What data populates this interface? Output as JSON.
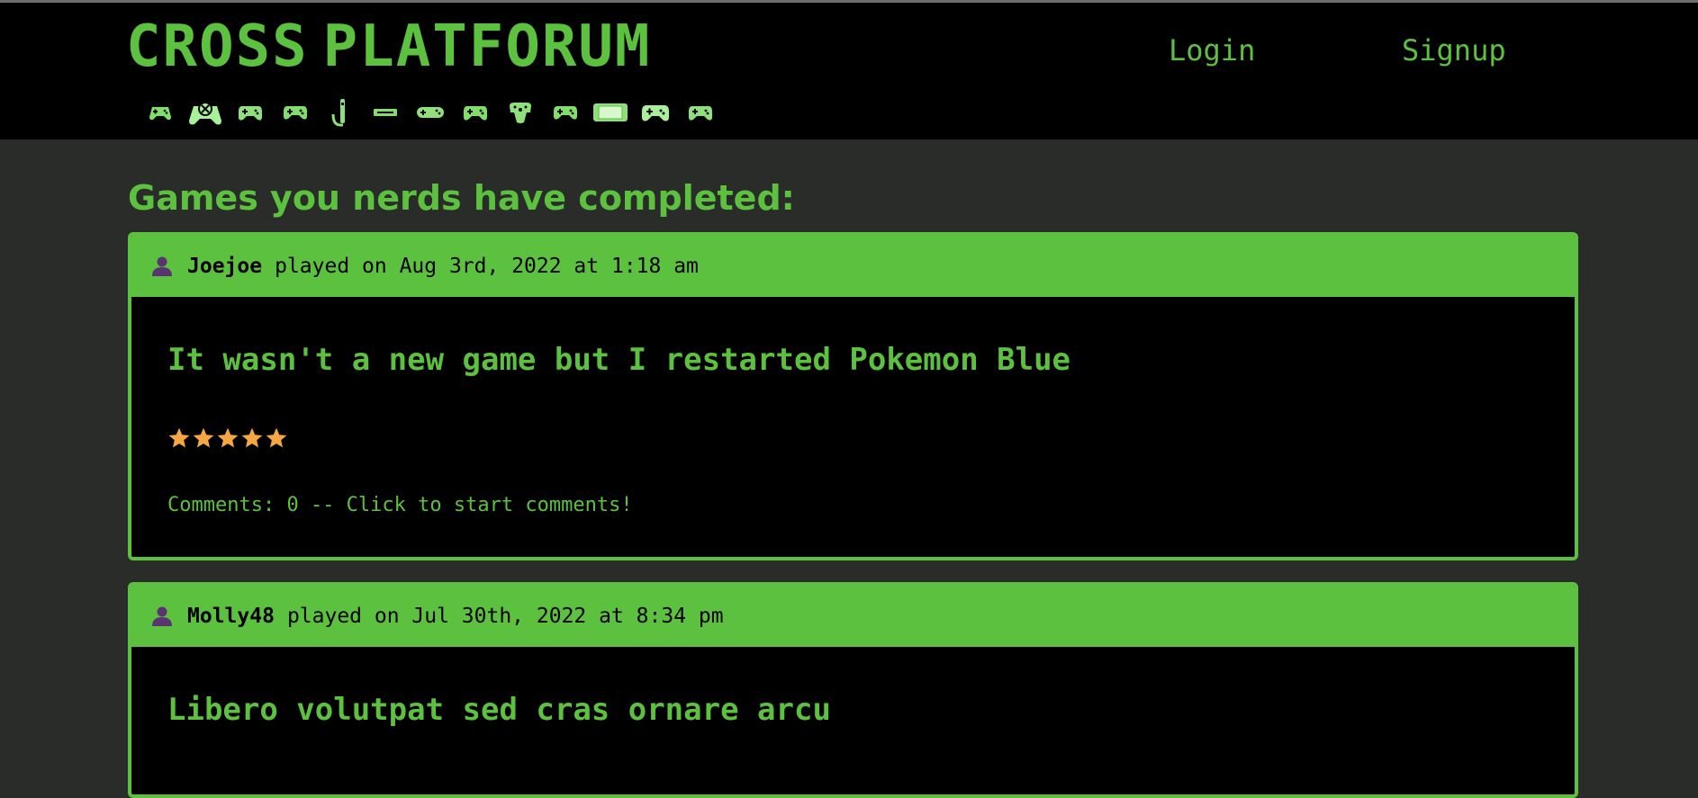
{
  "site": {
    "logo_part1": "Cross",
    "logo_part2": "Platforum"
  },
  "nav": {
    "login": "Login",
    "signup": "Signup"
  },
  "platforms": [
    {
      "name": "controller-icon"
    },
    {
      "name": "xbox-controller-icon"
    },
    {
      "name": "gamepad-icon"
    },
    {
      "name": "gamepad-icon"
    },
    {
      "name": "wii-remote-icon"
    },
    {
      "name": "handheld-icon"
    },
    {
      "name": "snes-controller-icon"
    },
    {
      "name": "gamepad-icon"
    },
    {
      "name": "n64-controller-icon"
    },
    {
      "name": "gamepad-icon"
    },
    {
      "name": "switch-icon"
    },
    {
      "name": "gamepad-icon"
    },
    {
      "name": "gamepad-icon"
    }
  ],
  "colors": {
    "accent": "#5cc13f",
    "background": "#2a2c29",
    "header_bg": "#000000",
    "star": "#f4a742",
    "user_icon": "#5a3470"
  },
  "main": {
    "title": "Games you nerds have completed:"
  },
  "posts": [
    {
      "username": "Joejoe",
      "played_text": "played on Aug 3rd, 2022 at 1:18 am",
      "title": "It wasn't a new game but I restarted Pokemon Blue",
      "rating": 5,
      "comments": "Comments: 0 -- Click to start comments!"
    },
    {
      "username": "Molly48",
      "played_text": "played on Jul 30th, 2022 at 8:34 pm",
      "title": "Libero volutpat sed cras ornare arcu"
    }
  ]
}
